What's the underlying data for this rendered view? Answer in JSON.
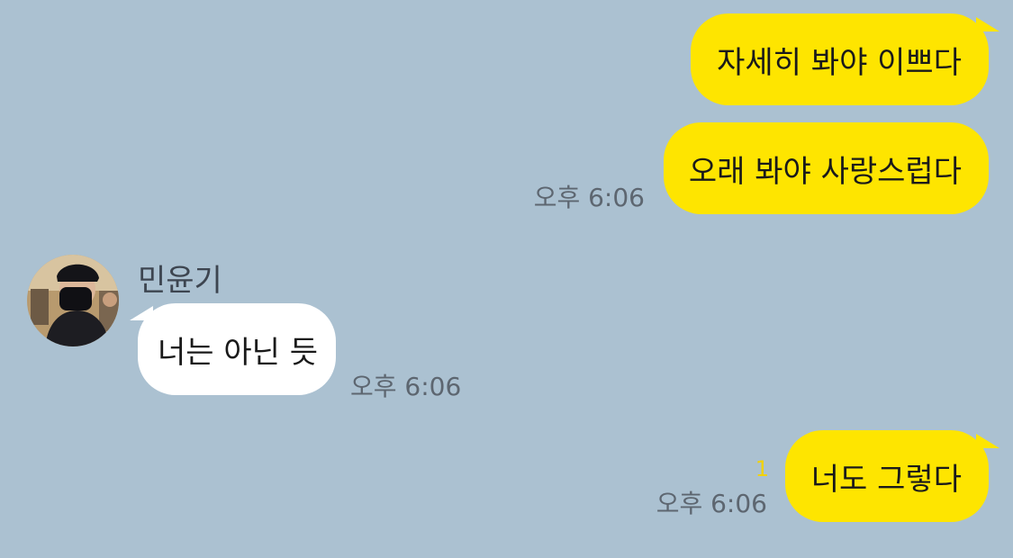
{
  "messages": {
    "m1": {
      "sender": "me",
      "text": "자세히 봐야 이쁘다"
    },
    "m2": {
      "sender": "me",
      "text": "오래 봐야 사랑스럽다",
      "time": "오후 6:06"
    },
    "m3": {
      "sender": "민윤기",
      "text": "너는 아닌 듯",
      "time": "오후 6:06"
    },
    "m4": {
      "sender": "me",
      "text": "너도 그렇다",
      "time": "오후 6:06",
      "unread": "1"
    }
  },
  "colors": {
    "background": "#abc1d1",
    "my_bubble": "#fee500",
    "other_bubble": "#ffffff",
    "unread_count": "#f2d200"
  },
  "icons": {
    "avatar": "profile-photo"
  }
}
